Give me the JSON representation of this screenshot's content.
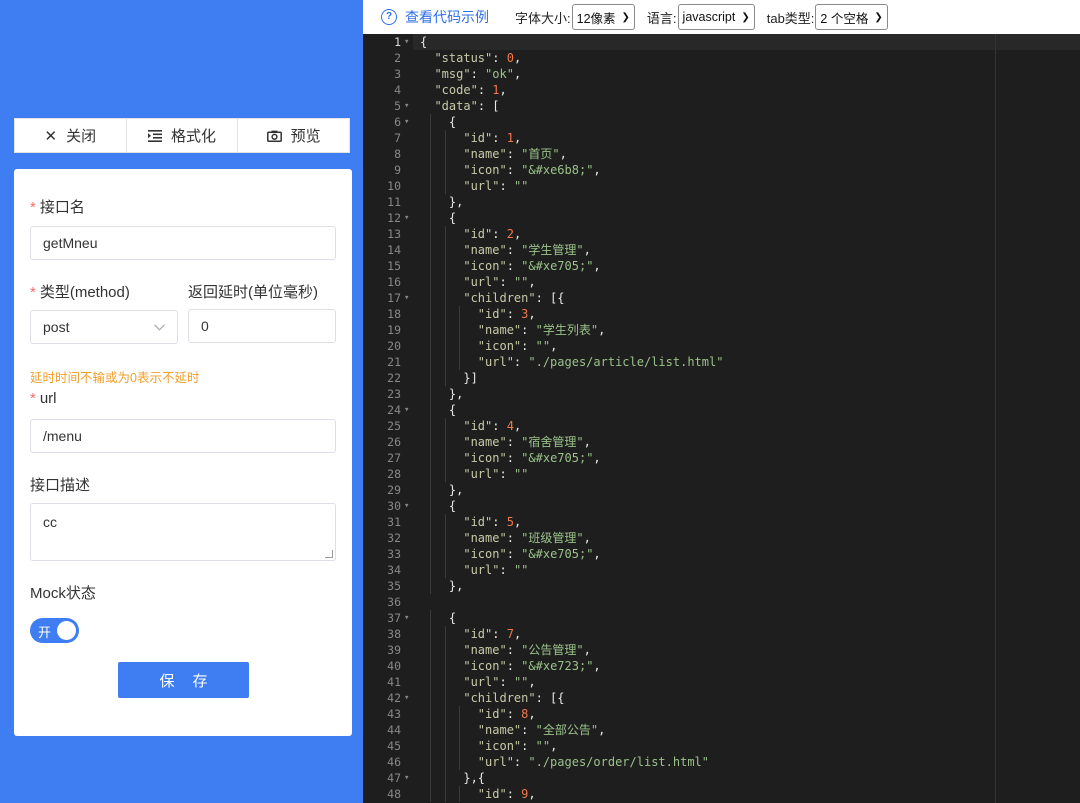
{
  "toolbar": {
    "example_link": "查看代码示例",
    "font_size_label": "字体大小:",
    "font_size_value": "12像素",
    "language_label": "语言:",
    "language_value": "javascript",
    "tab_label": "tab类型:",
    "tab_value": "2 个空格"
  },
  "actions": {
    "close": "关闭",
    "format": "格式化",
    "preview": "预览"
  },
  "form": {
    "name_label": "接口名",
    "name_value": "getMneu",
    "type_label": "类型(method)",
    "type_value": "post",
    "delay_label": "返回延时(单位毫秒)",
    "delay_value": "0",
    "delay_hint": "延时时间不输或为0表示不延时",
    "url_label": "url",
    "url_value": "/menu",
    "desc_label": "接口描述",
    "desc_value": "cc",
    "mock_label": "Mock状态",
    "mock_switch_text": "开",
    "mock_enabled": true,
    "save_label": "保存"
  },
  "colors": {
    "accent": "#3f7df2",
    "required": "#f56c6c",
    "hint": "#f2a02d",
    "editor_bg": "#1e1e1e",
    "string": "#9ac28a",
    "number": "#f2784b"
  },
  "editor": {
    "lines": [
      "{",
      "  \"status\": 0,",
      "  \"msg\": \"ok\",",
      "  \"code\": 1,",
      "  \"data\": [",
      "    {",
      "      \"id\": 1,",
      "      \"name\": \"首页\",",
      "      \"icon\": \"&#xe6b8;\",",
      "      \"url\": \"\"",
      "    },",
      "    {",
      "      \"id\": 2,",
      "      \"name\": \"学生管理\",",
      "      \"icon\": \"&#xe705;\",",
      "      \"url\": \"\",",
      "      \"children\": [{",
      "        \"id\": 3,",
      "        \"name\": \"学生列表\",",
      "        \"icon\": \"\",",
      "        \"url\": \"./pages/article/list.html\"",
      "      }]",
      "    },",
      "    {",
      "      \"id\": 4,",
      "      \"name\": \"宿舍管理\",",
      "      \"icon\": \"&#xe705;\",",
      "      \"url\": \"\"",
      "    },",
      "    {",
      "      \"id\": 5,",
      "      \"name\": \"班级管理\",",
      "      \"icon\": \"&#xe705;\",",
      "      \"url\": \"\"",
      "    },",
      "",
      "    {",
      "      \"id\": 7,",
      "      \"name\": \"公告管理\",",
      "      \"icon\": \"&#xe723;\",",
      "      \"url\": \"\",",
      "      \"children\": [{",
      "        \"id\": 8,",
      "        \"name\": \"全部公告\",",
      "        \"icon\": \"\",",
      "        \"url\": \"./pages/order/list.html\"",
      "      },{",
      "        \"id\": 9,"
    ],
    "fold_lines": [
      1,
      5,
      6,
      12,
      17,
      24,
      30,
      37,
      42,
      47
    ],
    "active_line": 1
  }
}
